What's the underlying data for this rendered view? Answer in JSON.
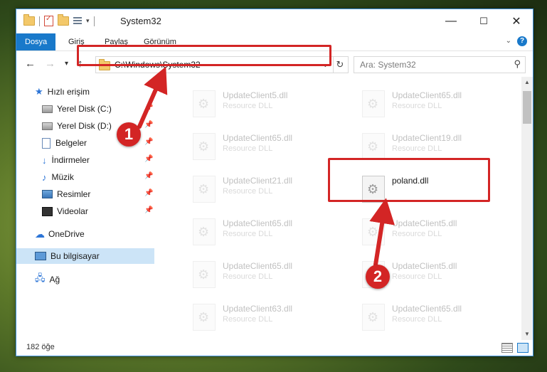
{
  "window": {
    "title": "System32",
    "controls": {
      "minimize": "—",
      "maximize": "☐",
      "close": "✕"
    }
  },
  "ribbon": {
    "tabs": [
      "Dosya",
      "Giriş",
      "Paylaş",
      "Görünüm"
    ],
    "help": "?"
  },
  "nav": {
    "back": "←",
    "forward": "→",
    "recent": "▾",
    "up": "↑",
    "address": "C:\\Windows\\System32",
    "address_chevron": "⌄",
    "refresh": "↻",
    "search_placeholder": "Ara: System32",
    "search_icon": "⚲"
  },
  "sidebar": {
    "items": [
      {
        "label": "Hızlı erişim",
        "icon": "star-icon"
      },
      {
        "label": "Yerel Disk (C:)",
        "icon": "drive-icon",
        "pinned": true
      },
      {
        "label": "Yerel Disk (D:)",
        "icon": "drive-icon",
        "pinned": true
      },
      {
        "label": "Belgeler",
        "icon": "documents-icon",
        "pinned": true
      },
      {
        "label": "İndirmeler",
        "icon": "download-icon",
        "pinned": true
      },
      {
        "label": "Müzik",
        "icon": "music-icon",
        "pinned": true
      },
      {
        "label": "Resimler",
        "icon": "pictures-icon",
        "pinned": true
      },
      {
        "label": "Videolar",
        "icon": "videos-icon",
        "pinned": true
      },
      {
        "label": "OneDrive",
        "icon": "cloud-icon"
      },
      {
        "label": "Bu bilgisayar",
        "icon": "computer-icon",
        "selected": true
      },
      {
        "label": "Ağ",
        "icon": "network-icon"
      }
    ]
  },
  "files": [
    {
      "name": "UpdateClient5.dll",
      "type": "Resource DLL"
    },
    {
      "name": "UpdateClient65.dll",
      "type": "Resource DLL"
    },
    {
      "name": "UpdateClient65.dll",
      "type": "Resource DLL"
    },
    {
      "name": "UpdateClient19.dll",
      "type": "Resource DLL"
    },
    {
      "name": "UpdateClient21.dll",
      "type": "Resource DLL"
    },
    {
      "name": "poland.dll",
      "type": "",
      "highlighted": true
    },
    {
      "name": "UpdateClient65.dll",
      "type": "Resource DLL"
    },
    {
      "name": "UpdateClient5.dll",
      "type": "Resource DLL"
    },
    {
      "name": "UpdateClient65.dll",
      "type": "Resource DLL"
    },
    {
      "name": "UpdateClient5.dll",
      "type": "Resource DLL"
    },
    {
      "name": "UpdateClient63.dll",
      "type": "Resource DLL"
    },
    {
      "name": "UpdateClient65.dll",
      "type": "Resource DLL"
    }
  ],
  "status": {
    "count": "182 öğe"
  },
  "annotations": {
    "marker1": "1",
    "marker2": "2",
    "color": "#d32525"
  }
}
